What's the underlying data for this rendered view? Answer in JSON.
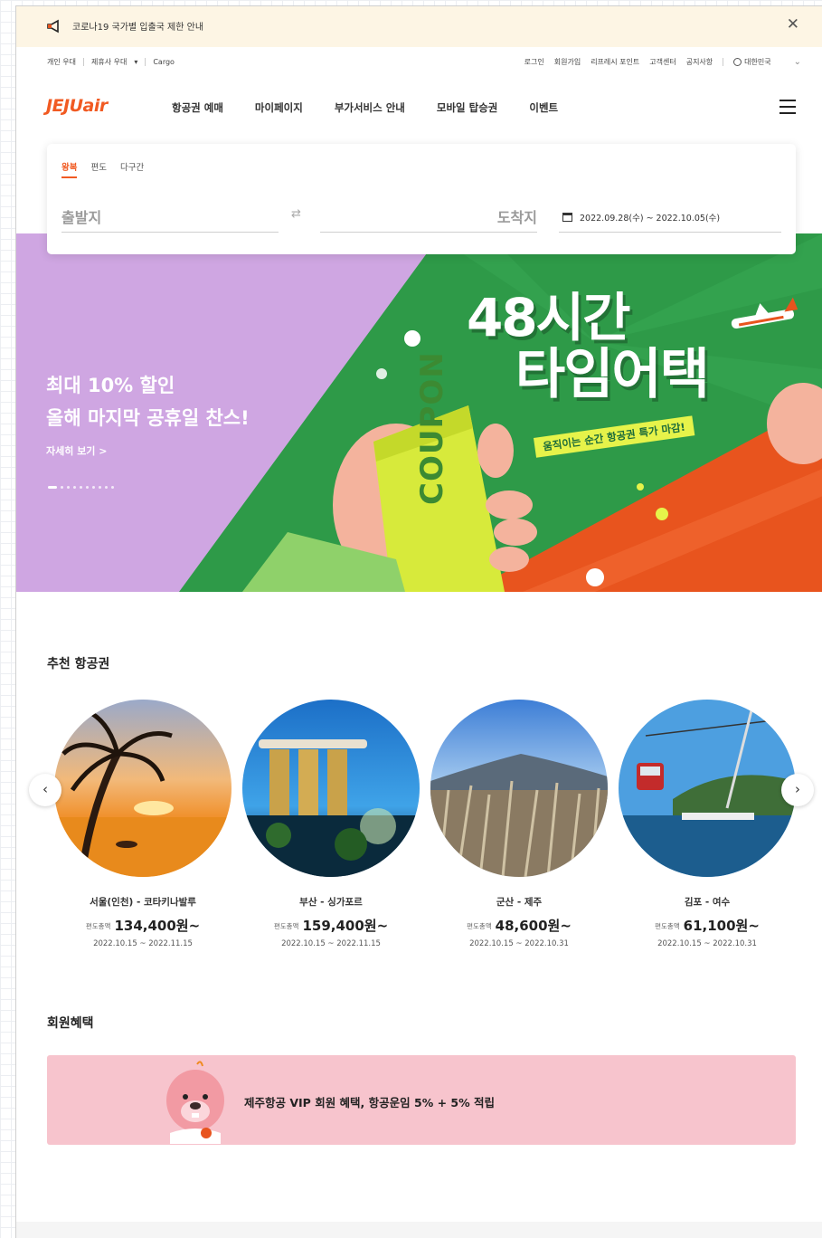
{
  "notice": {
    "text": "코로나19 국가별 입출국 제한 안내",
    "close_label": "✕"
  },
  "util_left": [
    "개인 우대",
    "제휴사 우대",
    "Cargo"
  ],
  "util_left_dropdown": "▾",
  "util_right": [
    "로그인",
    "회원가입",
    "리프레시 포인트",
    "고객센터",
    "공지사항"
  ],
  "language": "대한민국",
  "language_chevron": "⌄",
  "logo": "JEJUair",
  "gnb": [
    "항공권 예매",
    "마이페이지",
    "부가서비스 안내",
    "모바일 탑승권",
    "이벤트"
  ],
  "booking": {
    "tabs": [
      "왕복",
      "편도",
      "다구간"
    ],
    "from_placeholder": "출발지",
    "to_placeholder": "도착지",
    "swap_icon": "⇄",
    "date_range": "2022.09.28(수) ~ 2022.10.05(수)"
  },
  "hero": {
    "line1": "최대 10% 할인",
    "line2": "올해 마지막 공휴일 찬스!",
    "more": "자세히 보기 >",
    "title_line1": "48시간",
    "title_line2": "타임어택",
    "subtitle": "움직이는 순간 항공권 특가 마감!",
    "coupon": "COUPON",
    "slide_count": 10,
    "active_slide": 1
  },
  "recommend": {
    "title": "추천 항공권",
    "prev": "‹",
    "next": "›",
    "items": [
      {
        "route": "서울(인천) - 코타키나발루",
        "label": "편도총액",
        "price": "134,400원~",
        "dates": "2022.10.15 ~ 2022.11.15"
      },
      {
        "route": "부산 - 싱가포르",
        "label": "편도총액",
        "price": "159,400원~",
        "dates": "2022.10.15 ~ 2022.11.15"
      },
      {
        "route": "군산 - 제주",
        "label": "편도총액",
        "price": "48,600원~",
        "dates": "2022.10.15 ~ 2022.10.31"
      },
      {
        "route": "김포 - 여수",
        "label": "편도총액",
        "price": "61,100원~",
        "dates": "2022.10.15 ~ 2022.10.31"
      }
    ]
  },
  "benefit": {
    "title": "회원혜택",
    "text": "제주항공 VIP 회원 혜택, 항공운임 5% + 5% 적립"
  },
  "colors": {
    "brand": "#f15a22",
    "notice_bg": "#fdf5e4",
    "hero_left": "#cfa6e2",
    "hero_green": "#2d9a46",
    "hero_orange": "#e8541e",
    "benefit_bg": "#f7c4cd"
  },
  "icons": [
    "megaphone-icon",
    "close-icon",
    "globe-icon",
    "chevron-down-icon",
    "hamburger-icon",
    "swap-icon",
    "calendar-icon",
    "arrow-left-icon",
    "arrow-right-icon"
  ]
}
